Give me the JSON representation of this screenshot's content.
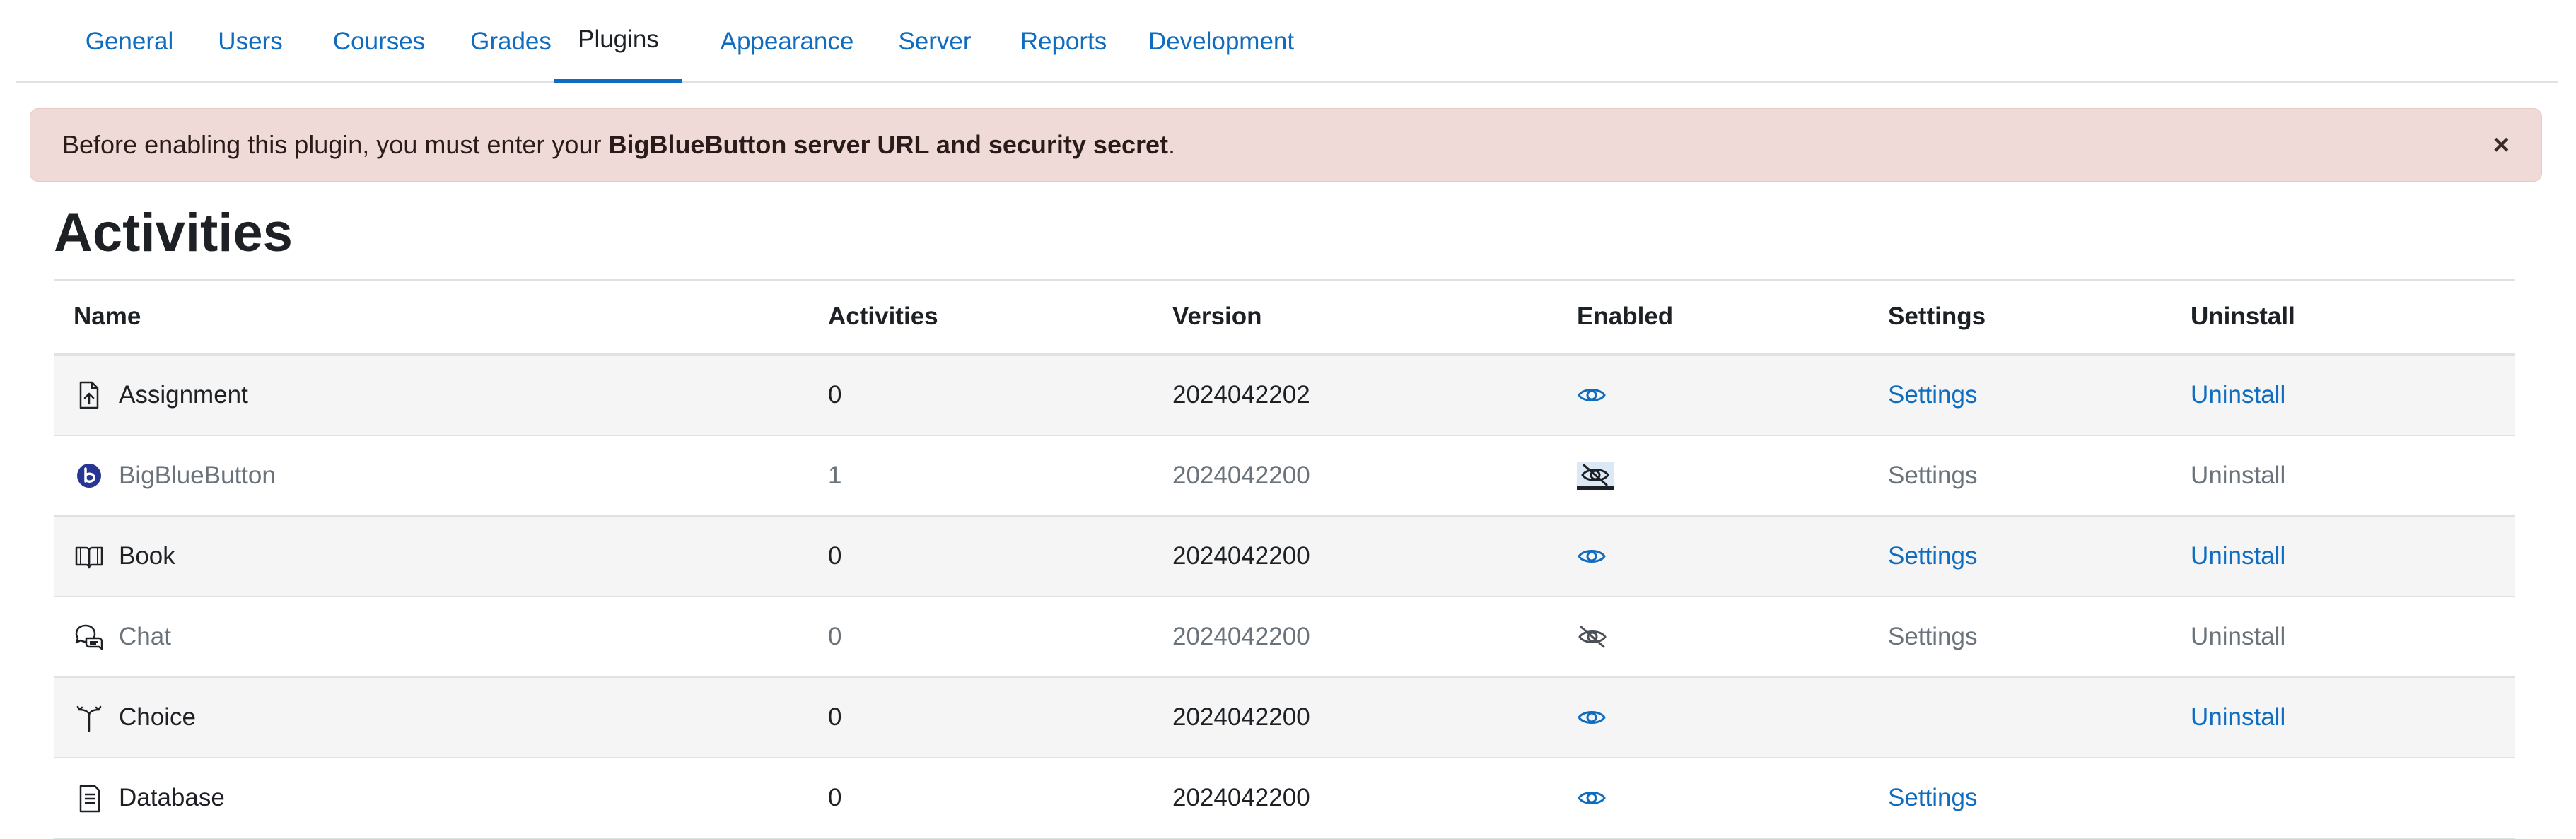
{
  "tabs": [
    {
      "label": "General"
    },
    {
      "label": "Users"
    },
    {
      "label": "Courses"
    },
    {
      "label": "Grades"
    },
    {
      "label": "Plugins",
      "active": true
    },
    {
      "label": "Appearance"
    },
    {
      "label": "Server"
    },
    {
      "label": "Reports"
    },
    {
      "label": "Development"
    }
  ],
  "alert": {
    "text_before": "Before enabling this plugin, you must enter your ",
    "text_bold": "BigBlueButton server URL and security secret",
    "text_after": ".",
    "close_label": "×"
  },
  "heading": "Activities",
  "table": {
    "headers": {
      "name": "Name",
      "activities": "Activities",
      "version": "Version",
      "enabled": "Enabled",
      "settings": "Settings",
      "uninstall": "Uninstall"
    },
    "rows": [
      {
        "name": "Assignment",
        "icon": "assignment-icon",
        "activities": "0",
        "version": "2024042202",
        "enabled": true,
        "settings": "Settings",
        "uninstall": "Uninstall"
      },
      {
        "name": "BigBlueButton",
        "icon": "bigbluebutton-icon",
        "activities": "1",
        "version": "2024042200",
        "enabled": false,
        "settings": "Settings",
        "uninstall": "Uninstall"
      },
      {
        "name": "Book",
        "icon": "book-icon",
        "activities": "0",
        "version": "2024042200",
        "enabled": true,
        "settings": "Settings",
        "uninstall": "Uninstall"
      },
      {
        "name": "Chat",
        "icon": "chat-icon",
        "activities": "0",
        "version": "2024042200",
        "enabled": false,
        "settings": "Settings",
        "uninstall": "Uninstall"
      },
      {
        "name": "Choice",
        "icon": "choice-icon",
        "activities": "0",
        "version": "2024042200",
        "enabled": true,
        "settings": "",
        "uninstall": "Uninstall"
      },
      {
        "name": "Database",
        "icon": "database-icon",
        "activities": "0",
        "version": "2024042200",
        "enabled": true,
        "settings": "Settings",
        "uninstall": ""
      }
    ]
  },
  "colors": {
    "link": "#0f6cbf",
    "alert_bg": "#efdad7",
    "dimmed_text": "#6a737b",
    "stripe_bg": "#f5f5f5"
  }
}
